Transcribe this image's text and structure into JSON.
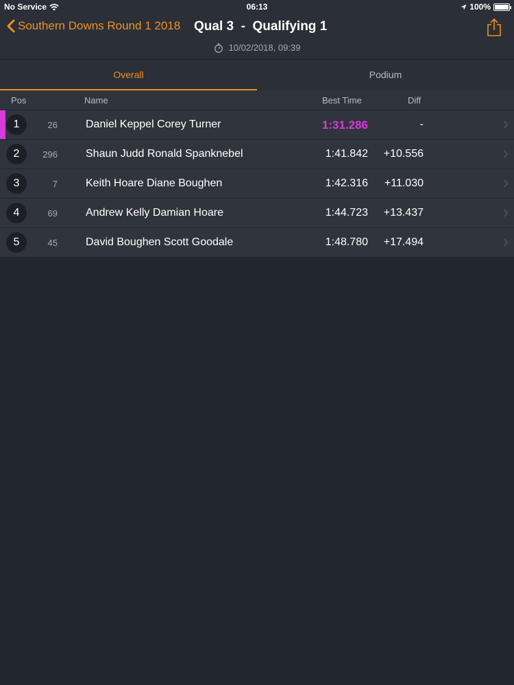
{
  "status": {
    "carrier": "No Service",
    "time": "06:13",
    "battery": "100%"
  },
  "nav": {
    "back_label": "Southern Downs Round 1 2018",
    "title": "Qual 3  -  Qualifying 1",
    "datetime": "10/02/2018, 09:39"
  },
  "tabs": [
    {
      "label": "Overall",
      "active": true
    },
    {
      "label": "Podium",
      "active": false
    }
  ],
  "columns": {
    "pos": "Pos",
    "name": "Name",
    "best_time": "Best Time",
    "diff": "Diff"
  },
  "rows": [
    {
      "pos": "1",
      "number": "26",
      "name": "Daniel Keppel Corey Turner",
      "best_time": "1:31.286",
      "diff": "-"
    },
    {
      "pos": "2",
      "number": "296",
      "name": "Shaun Judd Ronald Spanknebel",
      "best_time": "1:41.842",
      "diff": "+10.556"
    },
    {
      "pos": "3",
      "number": "7",
      "name": "Keith Hoare Diane Boughen",
      "best_time": "1:42.316",
      "diff": "+11.030"
    },
    {
      "pos": "4",
      "number": "69",
      "name": "Andrew Kelly Damian Hoare",
      "best_time": "1:44.723",
      "diff": "+13.437"
    },
    {
      "pos": "5",
      "number": "45",
      "name": "David Boughen Scott Goodale",
      "best_time": "1:48.780",
      "diff": "+17.494"
    }
  ],
  "colors": {
    "accent": "#f0921e",
    "fastest": "#d83bdc",
    "background": "#22262e"
  }
}
